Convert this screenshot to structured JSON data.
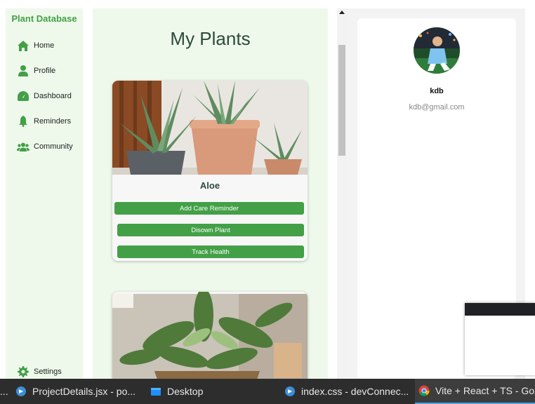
{
  "sidebar": {
    "brand": "Plant Database",
    "items": [
      {
        "label": "Home",
        "icon": "home-icon"
      },
      {
        "label": "Profile",
        "icon": "user-icon"
      },
      {
        "label": "Dashboard",
        "icon": "dashboard-icon"
      },
      {
        "label": "Reminders",
        "icon": "bell-icon"
      },
      {
        "label": "Community",
        "icon": "users-icon"
      }
    ],
    "settings_label": "Settings"
  },
  "main": {
    "title": "My Plants",
    "cards": [
      {
        "name": "Aloe",
        "buttons": [
          "Add Care Reminder",
          "Disown Plant",
          "Track Health"
        ]
      }
    ]
  },
  "profile": {
    "name": "kdb",
    "email": "kdb@gmail.com"
  },
  "taskbar": {
    "items": [
      {
        "label": "...",
        "icon": ""
      },
      {
        "label": "ProjectDetails.jsx - po...",
        "icon": "vscode-icon"
      },
      {
        "label": "Desktop",
        "icon": "folder-icon"
      },
      {
        "label": "index.css - devConnec...",
        "icon": "vscode-icon"
      },
      {
        "label": "Vite + React + TS - Go...",
        "icon": "chrome-icon"
      }
    ]
  },
  "colors": {
    "accent": "#43a047",
    "panel_bg": "#eef9ec",
    "title": "#2e4a3a"
  }
}
